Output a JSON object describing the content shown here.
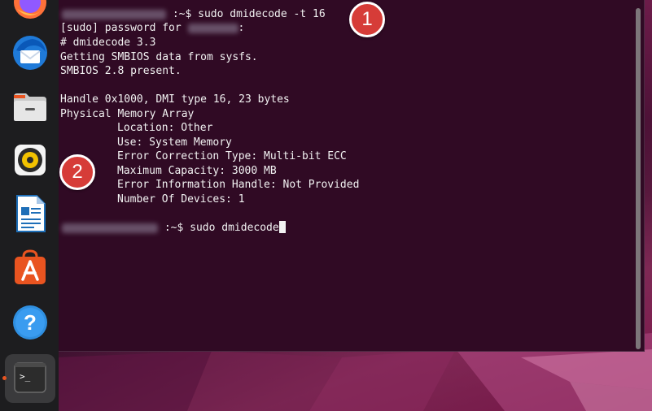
{
  "terminal": {
    "lines": [
      {
        "prompt_sep": ":~$",
        "command": "sudo dmidecode -t 16"
      },
      {
        "text_before": "[sudo] password for",
        "text_after": ":"
      },
      {
        "text": "# dmidecode 3.3"
      },
      {
        "text": "Getting SMBIOS data from sysfs."
      },
      {
        "text": "SMBIOS 2.8 present."
      },
      {
        "text": "Handle 0x1000, DMI type 16, 23 bytes"
      },
      {
        "text": "Physical Memory Array"
      },
      {
        "text": "Location: Other"
      },
      {
        "text": "Use: System Memory"
      },
      {
        "text": "Error Correction Type: Multi-bit ECC"
      },
      {
        "text": "Maximum Capacity: 3000 MB"
      },
      {
        "text": "Error Information Handle: Not Provided"
      },
      {
        "text": "Number Of Devices: 1"
      }
    ],
    "current_prompt": {
      "prompt_sep": ":~$",
      "command": "sudo dmidecode"
    }
  },
  "badges": [
    "1",
    "2"
  ],
  "dock": {
    "items": [
      "firefox-icon",
      "thunderbird-icon",
      "files-icon",
      "rhythmbox-icon",
      "libreoffice-writer-icon",
      "ubuntu-software-icon",
      "help-icon",
      "terminal-icon"
    ],
    "terminal_glyph": ">_"
  },
  "colors": {
    "terminal_bg": "#300a24",
    "text": "#f2f2f2",
    "badge": "#d63c38",
    "dock_bg": "#1d1d1f",
    "accent": "#e95420"
  }
}
